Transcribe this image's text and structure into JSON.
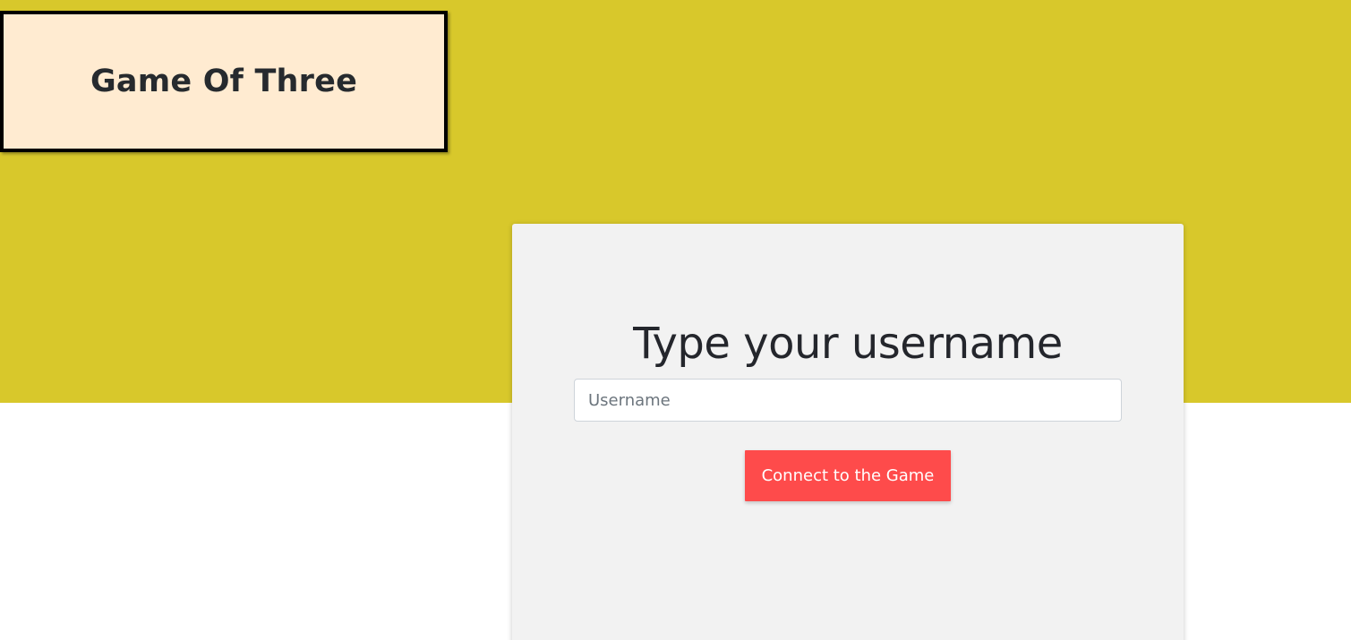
{
  "app": {
    "title": "Game Of Three"
  },
  "login": {
    "heading": "Type your username",
    "username_placeholder": "Username",
    "username_value": "",
    "connect_label": "Connect to the Game"
  },
  "colors": {
    "hero_background": "#d8c82b",
    "logo_background": "#ffebd1",
    "card_background": "#f2f2f2",
    "button_background": "#fe4b4b"
  }
}
